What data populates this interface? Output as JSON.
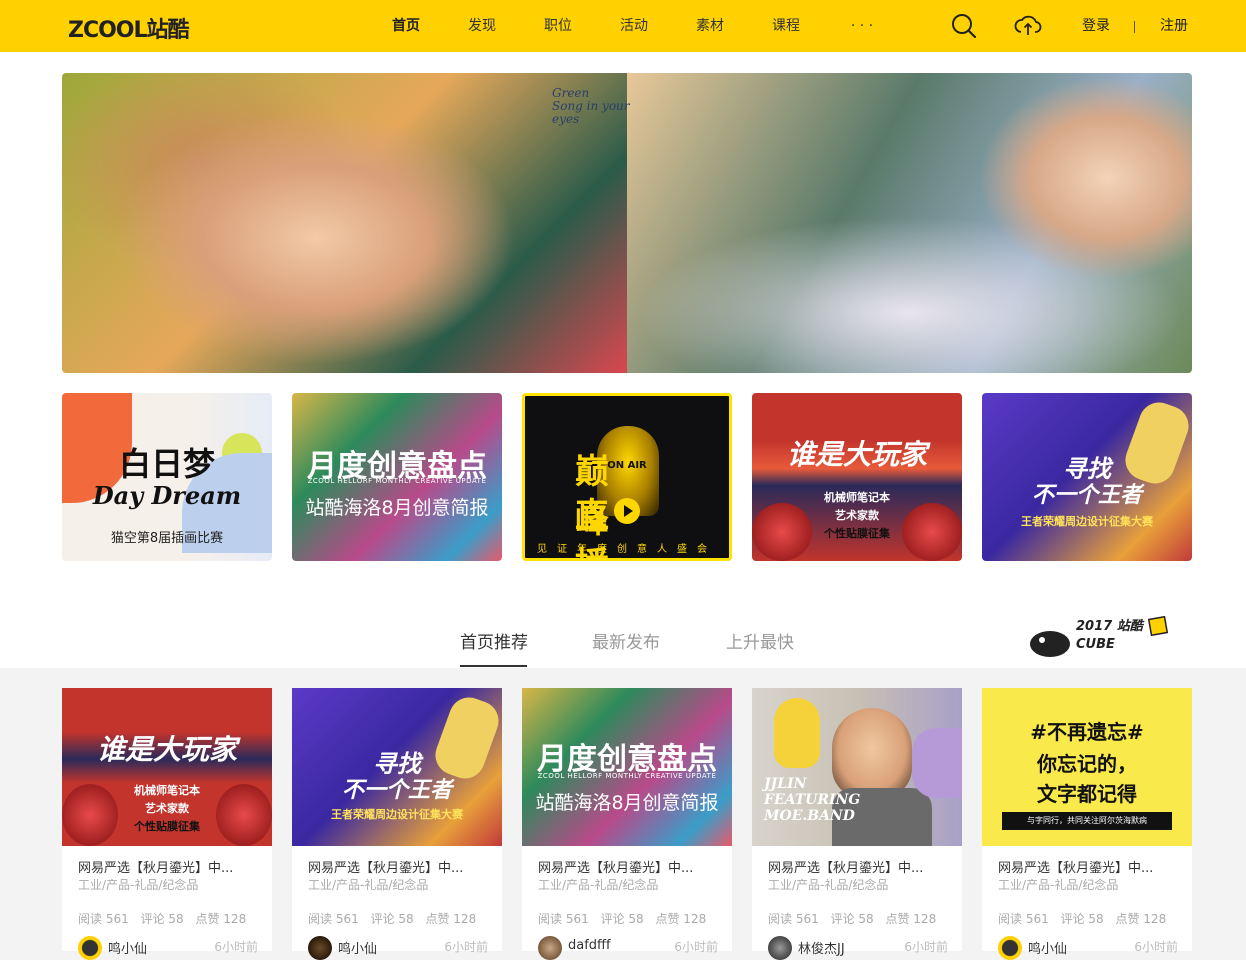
{
  "header": {
    "logo": "ZCOOL站酷",
    "nav": [
      "首页",
      "发现",
      "职位",
      "活动",
      "素材",
      "课程",
      "· · ·"
    ],
    "active_index": 0,
    "login": "登录",
    "register": "注册"
  },
  "banner": {
    "text_lines": [
      "Green",
      "Song in your",
      "eyes"
    ]
  },
  "promos": [
    {
      "lines": [
        "白日梦",
        "Day Dream",
        "猫空第8届插画比赛"
      ],
      "bg": "#f7f2ee"
    },
    {
      "lines": [
        "月度创意盘点",
        "ZCOOL HELLORF MONTHLY CREATIVE UPDATE",
        "站酷海洛8月创意简报"
      ],
      "bg": "#3a8a6a"
    },
    {
      "lines": [
        "巅峰",
        "直播",
        "ON AIR",
        "见证年度创意人盛会"
      ],
      "bg": "#151515"
    },
    {
      "lines": [
        "谁是大玩家",
        "机械师笔记本",
        "艺术家款",
        "个性贴膜征集"
      ],
      "bg": "#2b2f6b"
    },
    {
      "lines": [
        "寻找",
        "不一个王者",
        "王者荣耀周边设计征集大赛"
      ],
      "bg": "#4332a6"
    }
  ],
  "tabs": {
    "items": [
      "首页推荐",
      "最新发布",
      "上升最快"
    ],
    "active_index": 0
  },
  "cube_badge": "2017 站酷CUBE",
  "cards": [
    {
      "title": "网易严选【秋月鎏光】中...",
      "category": "工业/产品-礼品/纪念品",
      "reads": "阅读 561",
      "comments": "评论 58",
      "likes": "点赞 128",
      "author": "鸣小仙",
      "time": "6小时前",
      "thumb_lines": [
        "谁是大玩家",
        "机械师笔记本",
        "艺术家款",
        "个性贴膜征集"
      ]
    },
    {
      "title": "网易严选【秋月鎏光】中...",
      "category": "工业/产品-礼品/纪念品",
      "reads": "阅读 561",
      "comments": "评论 58",
      "likes": "点赞 128",
      "author": "鸣小仙",
      "time": "6小时前",
      "thumb_lines": [
        "寻找",
        "不一个王者",
        "王者荣耀周边设计征集大赛"
      ]
    },
    {
      "title": "网易严选【秋月鎏光】中...",
      "category": "工业/产品-礼品/纪念品",
      "reads": "阅读 561",
      "comments": "评论 58",
      "likes": "点赞 128",
      "author": "dafdfff",
      "time": "6小时前",
      "thumb_lines": [
        "月度创意盘点",
        "ZCOOL HELLORF MONTHLY CREATIVE UPDATE",
        "站酷海洛8月创意简报"
      ]
    },
    {
      "title": "网易严选【秋月鎏光】中...",
      "category": "工业/产品-礼品/纪念品",
      "reads": "阅读 561",
      "comments": "评论 58",
      "likes": "点赞 128",
      "author": "林俊杰JJ",
      "time": "6小时前",
      "thumb_lines": [
        "JJLIN",
        "FEATURING",
        "MOE.BAND"
      ]
    },
    {
      "title": "网易严选【秋月鎏光】中...",
      "category": "工业/产品-礼品/纪念品",
      "reads": "阅读 561",
      "comments": "评论 58",
      "likes": "点赞 128",
      "author": "鸣小仙",
      "time": "6小时前",
      "thumb_lines": [
        "#不再遗忘#",
        "你忘记的，",
        "文字都记得",
        "与字同行，共同关注阿尔茨海默病"
      ]
    }
  ]
}
